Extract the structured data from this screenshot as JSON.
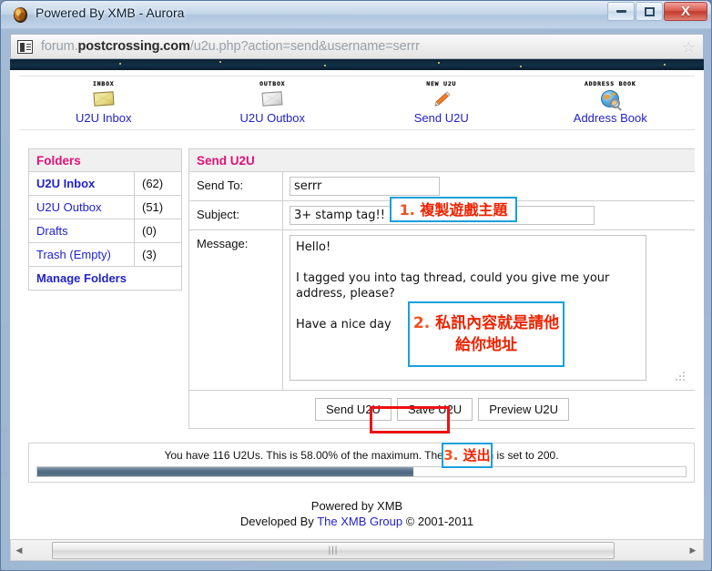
{
  "window": {
    "title": "Powered By XMB - Aurora",
    "minimize_label": "Minimize",
    "maximize_label": "Maximize",
    "close_label": "X"
  },
  "address_bar": {
    "url_prefix": "forum.",
    "url_domain": "postcrossing.com",
    "url_path": "/u2u.php?action=send&username=serrr",
    "favicon_name": "page-icon",
    "star_glyph": "☆"
  },
  "nav": {
    "items": [
      {
        "pixel_label": "INBOX",
        "label": "U2U Inbox",
        "icon": "inbox-envelope-icon"
      },
      {
        "pixel_label": "OUTBOX",
        "label": "U2U Outbox",
        "icon": "outbox-envelope-icon"
      },
      {
        "pixel_label": "NEW U2U",
        "label": "Send U2U",
        "icon": "pencil-icon"
      },
      {
        "pixel_label": "ADDRESS BOOK",
        "label": "Address Book",
        "icon": "globe-search-icon"
      }
    ]
  },
  "folders": {
    "header": "Folders",
    "rows": [
      {
        "name": "U2U Inbox",
        "count": "(62)"
      },
      {
        "name": "U2U Outbox",
        "count": "(51)"
      },
      {
        "name": "Drafts",
        "count": "(0)"
      },
      {
        "name": "Trash (Empty)",
        "count": "(3)"
      }
    ],
    "manage_label": "Manage Folders"
  },
  "form": {
    "header": "Send U2U",
    "send_to_label": "Send To:",
    "send_to_value": "serrr",
    "subject_label": "Subject:",
    "subject_value": "3+ stamp tag!!",
    "message_label": "Message:",
    "message_value": "Hello!\n\nI tagged you into tag thread, could you give me your address, please?\n\nHave a nice day",
    "buttons": {
      "send": "Send U2U",
      "save": "Save U2U",
      "preview": "Preview U2U"
    }
  },
  "quota": {
    "text": "You have 116 U2Us. This is 58.00% of the maximum. The maximum is set to 200.",
    "used": 116,
    "maximum": 200,
    "percent": "58.00%",
    "fill_percent": 58
  },
  "footer": {
    "line1": "Powered by XMB",
    "line2_prefix": "Developed By ",
    "link": "The XMB Group",
    "line2_suffix": " © 2001-2011"
  },
  "annotations": [
    {
      "id": "anno-1",
      "number": "1.",
      "text": "複製遊戲主題"
    },
    {
      "id": "anno-2",
      "number": "2.",
      "text": "私訊內容就是請他\n給你地址"
    },
    {
      "id": "anno-3",
      "number": "3.",
      "text": "送出"
    }
  ],
  "colors": {
    "accent_pink": "#e0127a",
    "link_blue": "#2222cc",
    "annotation_red": "#ee2200",
    "annotation_border": "#16a0dd",
    "highlight_red": "#ee1111",
    "progress_fill": "#55718c"
  },
  "scrollbar": {
    "left_arrow": "◀",
    "right_arrow": "▶",
    "grip": "|||"
  }
}
